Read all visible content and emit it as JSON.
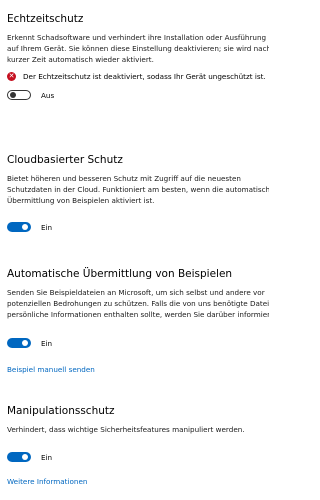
{
  "sections": [
    {
      "title": "Echtzeitschutz",
      "description": [
        "Erkennt Schadsoftware und verhindert ihre Installation oder Ausführung",
        "auf Ihrem Gerät. Sie können diese Einstellung deaktivieren; sie wird nach",
        "kurzer Zeit automatisch wieder aktiviert."
      ],
      "warning": "Der Echtzeitschutz ist deaktiviert, sodass Ihr Gerät ungeschützt ist.",
      "toggle": {
        "state": "off",
        "label": "Aus"
      }
    },
    {
      "title": "Cloudbasierter Schutz",
      "description": [
        "Bietet höheren und besseren Schutz mit Zugriff auf die neuesten",
        "Schutzdaten in der Cloud. Funktioniert am besten, wenn die automatische",
        "Übermittlung von Beispielen aktiviert ist."
      ],
      "toggle": {
        "state": "on",
        "label": "Ein"
      }
    },
    {
      "title": "Automatische Übermittlung von Beispielen",
      "description": [
        "Senden Sie Beispieldateien an Microsoft, um sich selbst und andere vor",
        "potenziellen Bedrohungen zu schützen. Falls die von uns benötigte Datei",
        "persönliche Informationen enthalten sollte, werden Sie darüber informiert."
      ],
      "toggle": {
        "state": "on",
        "label": "Ein"
      },
      "link": "Beispiel manuell senden"
    },
    {
      "title": "Manipulationsschutz",
      "description": [
        "Verhindert, dass wichtige Sicherheitsfeatures manipuliert werden."
      ],
      "toggle": {
        "state": "on",
        "label": "Ein"
      },
      "link": "Weitere Informationen"
    }
  ],
  "colors": {
    "accent": "#0067c0",
    "error": "#c50f1f"
  },
  "icons": {
    "warning": "error-circle-icon"
  }
}
